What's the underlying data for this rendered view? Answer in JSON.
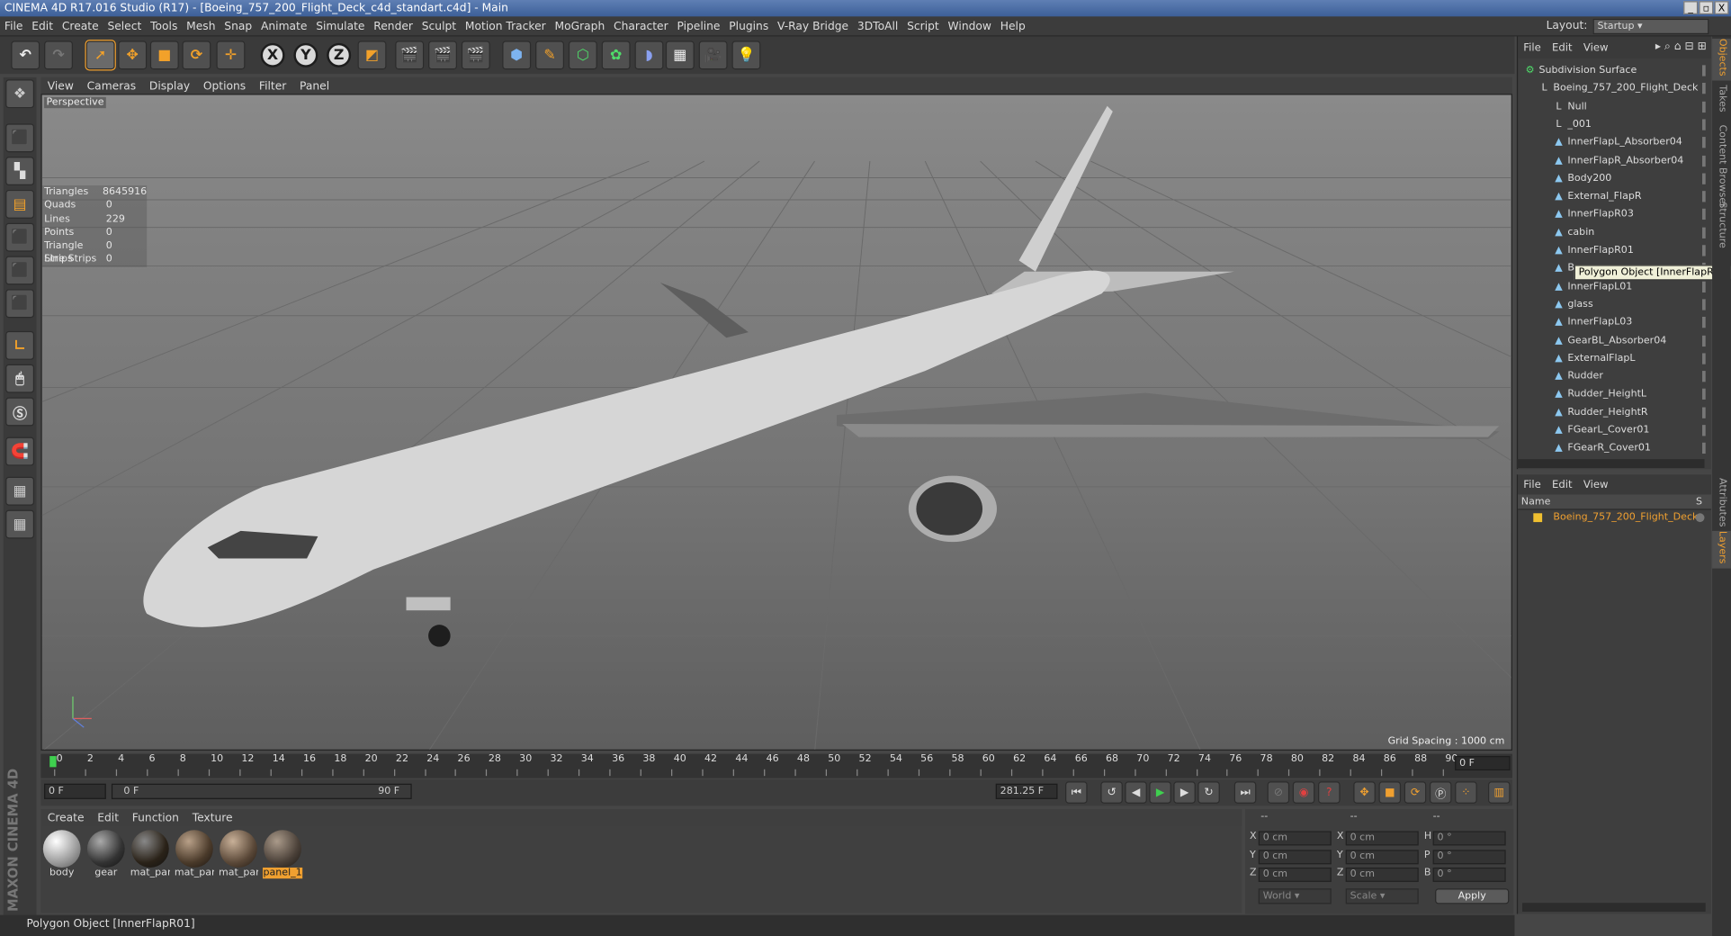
{
  "window": {
    "title": "CINEMA 4D R17.016 Studio (R17) - [Boeing_757_200_Flight_Deck_c4d_standart.c4d] - Main",
    "minimize": "_",
    "maximize": "▫",
    "close": "X"
  },
  "menu": [
    "File",
    "Edit",
    "Create",
    "Select",
    "Tools",
    "Mesh",
    "Snap",
    "Animate",
    "Simulate",
    "Render",
    "Sculpt",
    "Motion Tracker",
    "MoGraph",
    "Character",
    "Pipeline",
    "Plugins",
    "V-Ray Bridge",
    "3DToAll",
    "Script",
    "Window",
    "Help"
  ],
  "layout": {
    "label": "Layout:",
    "value": "Startup"
  },
  "toolbar": {
    "x_label": "X",
    "y_label": "Y",
    "z_label": "Z"
  },
  "viewport": {
    "menu": [
      "View",
      "Cameras",
      "Display",
      "Options",
      "Filter",
      "Panel"
    ],
    "camera_label": "Perspective",
    "grid_spacing": "Grid Spacing : 1000 cm",
    "stats": [
      {
        "k": "Triangles",
        "v": "8645916"
      },
      {
        "k": "Quads",
        "v": "0"
      },
      {
        "k": "Lines",
        "v": "229"
      },
      {
        "k": "Points",
        "v": "0"
      },
      {
        "k": "Triangle Strips",
        "v": "0"
      },
      {
        "k": "Line Strips",
        "v": "0"
      }
    ]
  },
  "timeline": {
    "ticks": [
      "0",
      "2",
      "4",
      "6",
      "8",
      "10",
      "12",
      "14",
      "16",
      "18",
      "20",
      "22",
      "24",
      "26",
      "28",
      "30",
      "32",
      "34",
      "36",
      "38",
      "40",
      "42",
      "44",
      "46",
      "48",
      "50",
      "52",
      "54",
      "56",
      "58",
      "60",
      "62",
      "64",
      "66",
      "68",
      "70",
      "72",
      "74",
      "76",
      "78",
      "80",
      "82",
      "84",
      "86",
      "88",
      "90"
    ],
    "current_frame": "0 F",
    "start_field": "0 F",
    "range_start": "0 F",
    "range_end": "90 F",
    "end_field": "281.25 F"
  },
  "materials": {
    "menu": [
      "Create",
      "Edit",
      "Function",
      "Texture"
    ],
    "items": [
      {
        "label": "body",
        "selected": false
      },
      {
        "label": "gear",
        "selected": false
      },
      {
        "label": "mat_pan",
        "selected": false
      },
      {
        "label": "mat_pan",
        "selected": false
      },
      {
        "label": "mat_pan",
        "selected": false
      },
      {
        "label": "panel_1",
        "selected": true
      }
    ]
  },
  "coords": {
    "headers": [
      "--",
      "--",
      "--"
    ],
    "rows": [
      {
        "a": "X",
        "av": "0 cm",
        "b": "X",
        "bv": "0 cm",
        "c": "H",
        "cv": "0 °"
      },
      {
        "a": "Y",
        "av": "0 cm",
        "b": "Y",
        "bv": "0 cm",
        "c": "P",
        "cv": "0 °"
      },
      {
        "a": "Z",
        "av": "0 cm",
        "b": "Z",
        "bv": "0 cm",
        "c": "B",
        "cv": "0 °"
      }
    ],
    "space": "World",
    "mode": "Scale",
    "apply": "Apply"
  },
  "status": "Polygon Object [InnerFlapR01]",
  "brand": "MAXON CINEMA 4D",
  "objects": {
    "menu": [
      "File",
      "Edit",
      "View"
    ],
    "items": [
      {
        "label": "Subdivision Surface",
        "icon": "⚙",
        "indent": 0
      },
      {
        "label": "Boeing_757_200_Flight_Deck",
        "icon": "L",
        "indent": 1
      },
      {
        "label": "Null",
        "icon": "L",
        "indent": 2
      },
      {
        "label": "_001",
        "icon": "L",
        "indent": 2
      },
      {
        "label": "InnerFlapL_Absorber04",
        "icon": "▲",
        "indent": 2
      },
      {
        "label": "InnerFlapR_Absorber04",
        "icon": "▲",
        "indent": 2
      },
      {
        "label": "Body200",
        "icon": "▲",
        "indent": 2
      },
      {
        "label": "External_FlapR",
        "icon": "▲",
        "indent": 2
      },
      {
        "label": "InnerFlapR03",
        "icon": "▲",
        "indent": 2
      },
      {
        "label": "cabin",
        "icon": "▲",
        "indent": 2
      },
      {
        "label": "InnerFlapR01",
        "icon": "▲",
        "indent": 2
      },
      {
        "label": "B",
        "icon": "▲",
        "indent": 2
      },
      {
        "label": "InnerFlapL01",
        "icon": "▲",
        "indent": 2
      },
      {
        "label": "glass",
        "icon": "▲",
        "indent": 2
      },
      {
        "label": "InnerFlapL03",
        "icon": "▲",
        "indent": 2
      },
      {
        "label": "GearBL_Absorber04",
        "icon": "▲",
        "indent": 2
      },
      {
        "label": "ExternalFlapL",
        "icon": "▲",
        "indent": 2
      },
      {
        "label": "Rudder",
        "icon": "▲",
        "indent": 2
      },
      {
        "label": "Rudder_HeightL",
        "icon": "▲",
        "indent": 2
      },
      {
        "label": "Rudder_HeightR",
        "icon": "▲",
        "indent": 2
      },
      {
        "label": "FGearL_Cover01",
        "icon": "▲",
        "indent": 2
      },
      {
        "label": "FGearR_Cover01",
        "icon": "▲",
        "indent": 2
      }
    ],
    "tooltip": "Polygon Object [InnerFlapR01]"
  },
  "layers": {
    "menu": [
      "File",
      "Edit",
      "View"
    ],
    "header_name": "Name",
    "header_s": "S",
    "row": "Boeing_757_200_Flight_Deck"
  },
  "vtabs": [
    "Objects",
    "Takes",
    "Content Browser",
    "Structure",
    "Attributes",
    "Layers"
  ],
  "colors": {
    "accent": "#f0a030",
    "title_bar": "#3c5f98"
  }
}
